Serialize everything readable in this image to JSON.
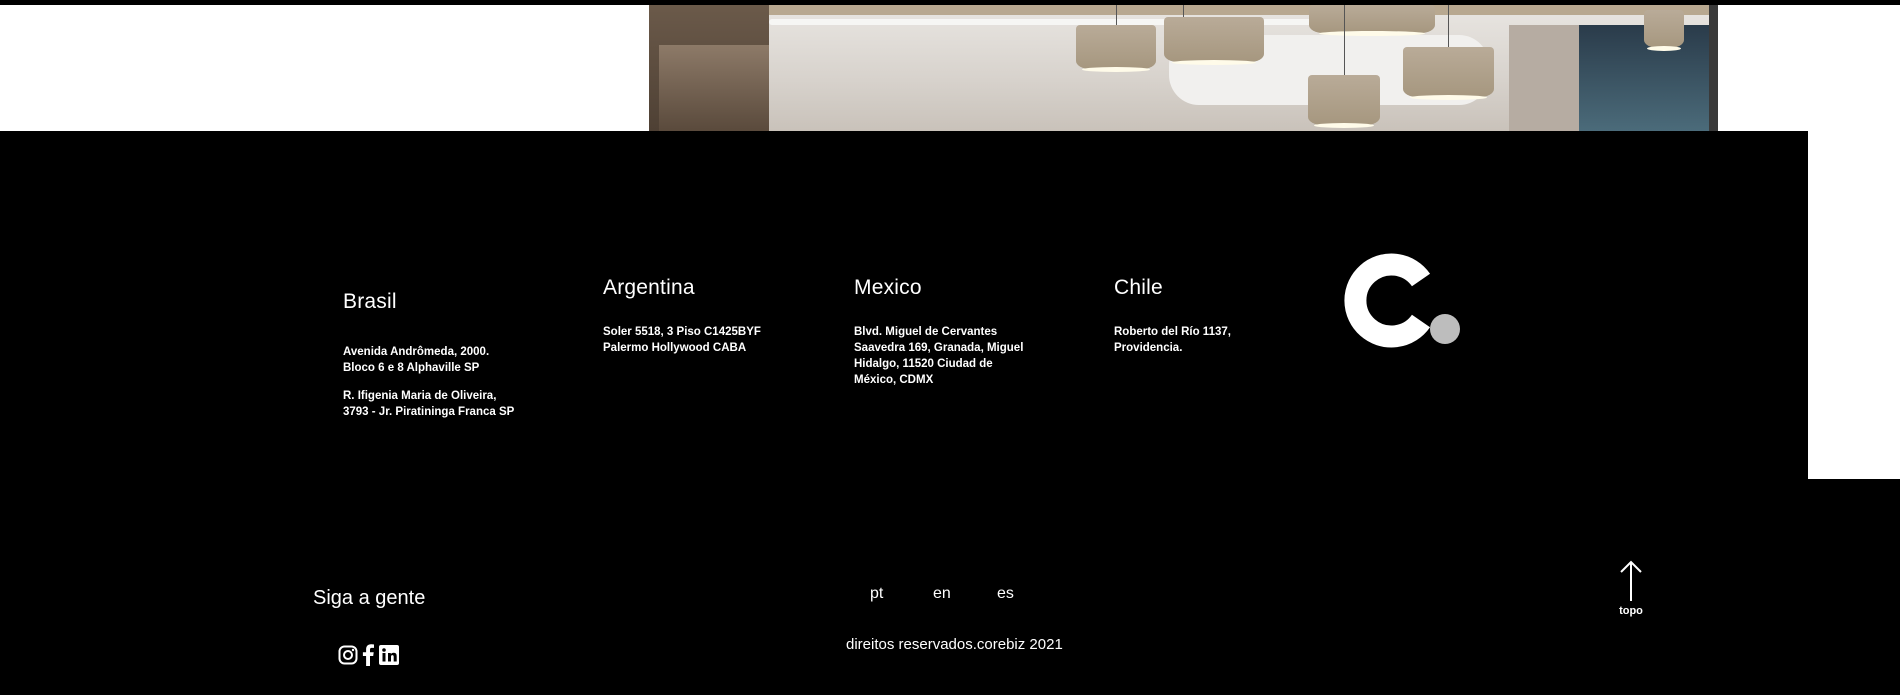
{
  "offices": [
    {
      "country": "Brasil",
      "addresses": [
        [
          "Avenida Andrômeda, 2000.",
          "Bloco 6 e 8 Alphaville SP"
        ],
        [
          "R. Ifigenia Maria de Oliveira,",
          "3793 - Jr. Piratininga Franca SP"
        ]
      ]
    },
    {
      "country": "Argentina",
      "addresses": [
        [
          "Soler 5518, 3 Piso C1425BYF",
          "Palermo Hollywood CABA"
        ]
      ]
    },
    {
      "country": "Mexico",
      "addresses": [
        [
          "Blvd. Miguel de Cervantes",
          "Saavedra 169, Granada, Miguel",
          "Hidalgo, 11520 Ciudad de",
          "México, CDMX"
        ]
      ]
    },
    {
      "country": "Chile",
      "addresses": [
        [
          "Roberto del Río 1137,",
          "Providencia."
        ]
      ]
    }
  ],
  "logo": {
    "letter_color": "#ffffff",
    "dot_color": "#bdbdbd"
  },
  "follow": {
    "title": "Siga a gente",
    "icons": [
      "instagram-icon",
      "facebook-icon",
      "linkedin-icon"
    ]
  },
  "languages": [
    "pt",
    "en",
    "es"
  ],
  "copyright": "direitos reservados.corebiz 2021",
  "back_to_top": {
    "label": "topo",
    "icon": "arrow-up-icon"
  }
}
